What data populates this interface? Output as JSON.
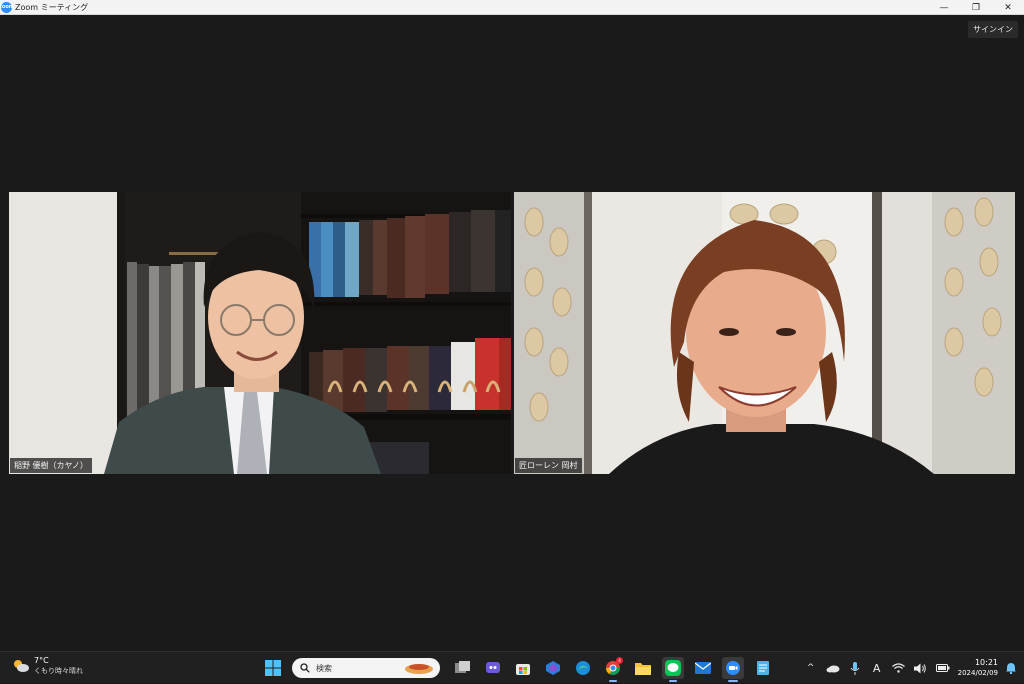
{
  "window": {
    "app_icon": "zoom-icon",
    "app_icon_text": "zoom",
    "title": "Zoom ミーティング",
    "controls": {
      "minimize": "—",
      "restore": "❐",
      "close": "✕"
    }
  },
  "meeting": {
    "signin_label": "サインイン",
    "participants": [
      {
        "name": "稲野 優樹（カヤノ）"
      },
      {
        "name": "匠ローレン 岡村"
      }
    ]
  },
  "taskbar": {
    "weather": {
      "temp": "7°C",
      "desc": "くもり時々晴れ"
    },
    "search_placeholder": "検索",
    "apps": [
      "start-icon",
      "task-view-icon",
      "copilot-icon",
      "store-icon",
      "bing-icon",
      "edge-icon",
      "chrome-icon",
      "file-explorer-icon",
      "line-icon",
      "mail-icon",
      "zoom-icon",
      "notepad-icon"
    ],
    "chrome_badge": "4",
    "tray": {
      "chevron": "^",
      "ime": "A"
    },
    "clock": {
      "time": "10:21",
      "date": "2024/02/09"
    }
  }
}
